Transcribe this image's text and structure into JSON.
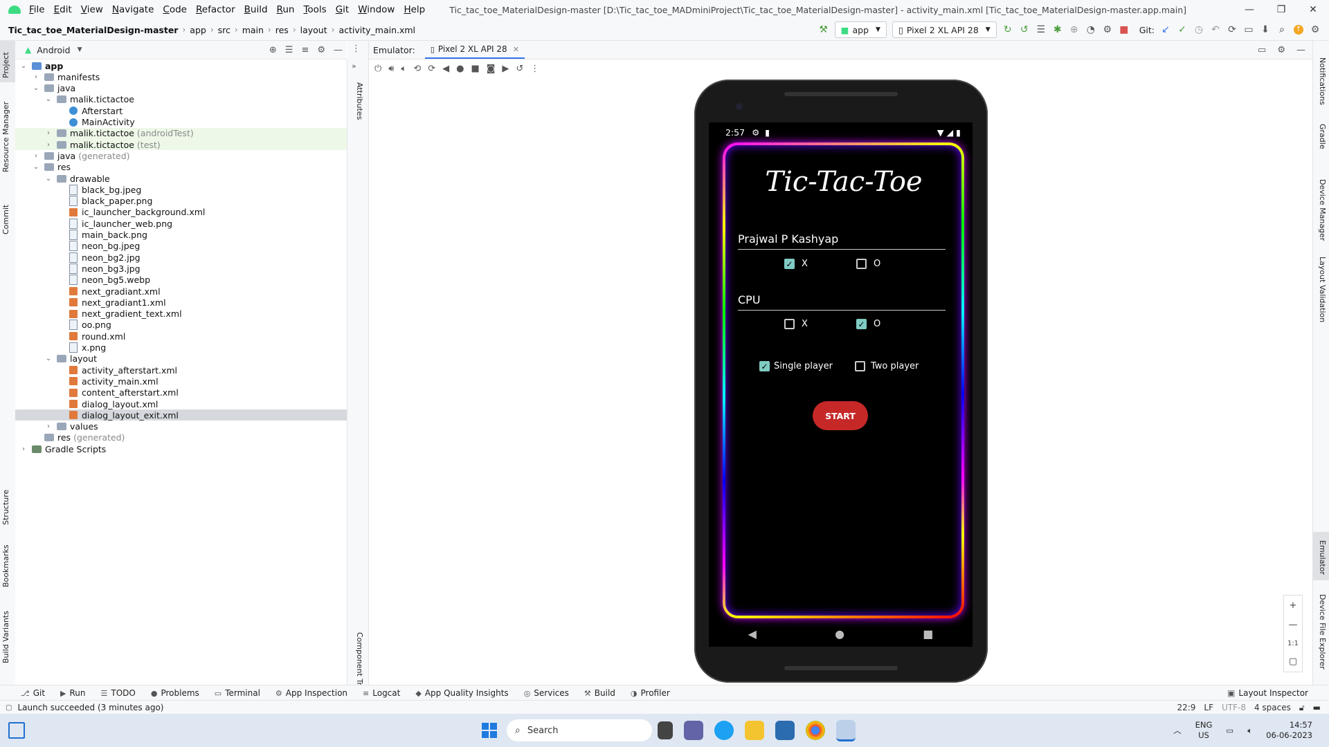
{
  "menubar": {
    "items": [
      "File",
      "Edit",
      "View",
      "Navigate",
      "Code",
      "Refactor",
      "Build",
      "Run",
      "Tools",
      "Git",
      "Window",
      "Help"
    ],
    "title": "Tic_tac_toe_MaterialDesign-master [D:\\Tic_tac_toe_MADminiProject\\Tic_tac_toe_MaterialDesign-master] - activity_main.xml [Tic_tac_toe_MaterialDesign-master.app.main]"
  },
  "breadcrumb": [
    "Tic_tac_toe_MaterialDesign-master",
    "app",
    "src",
    "main",
    "res",
    "layout",
    "activity_main.xml"
  ],
  "toolbar": {
    "run_config": "app",
    "device": "Pixel 2 XL API 28",
    "git_label": "Git:"
  },
  "project_panel": {
    "view": "Android",
    "tree": [
      {
        "label": "app",
        "depth": 0,
        "type": "module",
        "open": true,
        "bold": true
      },
      {
        "label": "manifests",
        "depth": 1,
        "type": "folder",
        "open": false
      },
      {
        "label": "java",
        "depth": 1,
        "type": "folder",
        "open": true
      },
      {
        "label": "malik.tictactoe",
        "depth": 2,
        "type": "package",
        "open": true
      },
      {
        "label": "Afterstart",
        "depth": 3,
        "type": "class"
      },
      {
        "label": "MainActivity",
        "depth": 3,
        "type": "class"
      },
      {
        "label": "malik.tictactoe",
        "suffix": "(androidTest)",
        "depth": 2,
        "type": "package",
        "open": false,
        "highlight": "green"
      },
      {
        "label": "malik.tictactoe",
        "suffix": "(test)",
        "depth": 2,
        "type": "package",
        "open": false,
        "highlight": "green"
      },
      {
        "label": "java",
        "suffix": "(generated)",
        "depth": 1,
        "type": "folder",
        "open": false
      },
      {
        "label": "res",
        "depth": 1,
        "type": "folder",
        "open": true
      },
      {
        "label": "drawable",
        "depth": 2,
        "type": "folder",
        "open": true
      },
      {
        "label": "black_bg.jpeg",
        "depth": 3,
        "type": "file"
      },
      {
        "label": "black_paper.png",
        "depth": 3,
        "type": "file"
      },
      {
        "label": "ic_launcher_background.xml",
        "depth": 3,
        "type": "xml"
      },
      {
        "label": "ic_launcher_web.png",
        "depth": 3,
        "type": "file"
      },
      {
        "label": "main_back.png",
        "depth": 3,
        "type": "file"
      },
      {
        "label": "neon_bg.jpeg",
        "depth": 3,
        "type": "file"
      },
      {
        "label": "neon_bg2.jpg",
        "depth": 3,
        "type": "file"
      },
      {
        "label": "neon_bg3.jpg",
        "depth": 3,
        "type": "file"
      },
      {
        "label": "neon_bg5.webp",
        "depth": 3,
        "type": "file"
      },
      {
        "label": "next_gradiant.xml",
        "depth": 3,
        "type": "xml"
      },
      {
        "label": "next_gradiant1.xml",
        "depth": 3,
        "type": "xml"
      },
      {
        "label": "next_gradient_text.xml",
        "depth": 3,
        "type": "xml"
      },
      {
        "label": "oo.png",
        "depth": 3,
        "type": "file"
      },
      {
        "label": "round.xml",
        "depth": 3,
        "type": "xml"
      },
      {
        "label": "x.png",
        "depth": 3,
        "type": "file"
      },
      {
        "label": "layout",
        "depth": 2,
        "type": "folder",
        "open": true
      },
      {
        "label": "activity_afterstart.xml",
        "depth": 3,
        "type": "xml"
      },
      {
        "label": "activity_main.xml",
        "depth": 3,
        "type": "xml"
      },
      {
        "label": "content_afterstart.xml",
        "depth": 3,
        "type": "xml"
      },
      {
        "label": "dialog_layout.xml",
        "depth": 3,
        "type": "xml"
      },
      {
        "label": "dialog_layout_exit.xml",
        "depth": 3,
        "type": "xml",
        "selected": true
      },
      {
        "label": "values",
        "depth": 2,
        "type": "folder",
        "open": false
      },
      {
        "label": "res",
        "suffix": "(generated)",
        "depth": 1,
        "type": "folder",
        "open": null
      },
      {
        "label": "Gradle Scripts",
        "depth": 0,
        "type": "gradle",
        "open": false
      }
    ]
  },
  "left_tabs": [
    "Project",
    "Resource Manager",
    "Commit",
    "Structure",
    "Bookmarks",
    "Build Variants"
  ],
  "mid_tabs": [
    "Attributes",
    "Component Tree"
  ],
  "right_tabs": [
    "Notifications",
    "Gradle",
    "Device Manager",
    "Layout Validation",
    "Emulator",
    "Device File Explorer"
  ],
  "emulator": {
    "label": "Emulator:",
    "tab": "Pixel 2 XL API 28",
    "zoom_label": "1:1"
  },
  "phone": {
    "time": "2:57",
    "title": "Tic-Tac-Toe",
    "player1": "Prajwal P Kashyap",
    "player2": "CPU",
    "p1_x_label": "X",
    "p1_o_label": "O",
    "p2_x_label": "X",
    "p2_o_label": "O",
    "single_label": "Single player",
    "two_label": "Two player",
    "start_label": "START",
    "checks": {
      "p1_x": true,
      "p1_o": false,
      "p2_x": false,
      "p2_o": true,
      "single": true,
      "two": false
    }
  },
  "toolwindows": [
    "Git",
    "Run",
    "TODO",
    "Problems",
    "Terminal",
    "App Inspection",
    "Logcat",
    "App Quality Insights",
    "Services",
    "Build",
    "Profiler"
  ],
  "layout_inspector": "Layout Inspector",
  "status": {
    "message": "Launch succeeded (3 minutes ago)",
    "position": "22:9",
    "line_sep": "LF",
    "encoding": "UTF-8",
    "indent": "4 spaces"
  },
  "taskbar": {
    "search": "Search",
    "lang1": "ENG",
    "lang2": "US",
    "time": "14:57",
    "date": "06-06-2023"
  },
  "colors": {
    "accent": "#3574f0",
    "start_button": "#c62828",
    "checkbox": "#80cbc4"
  }
}
